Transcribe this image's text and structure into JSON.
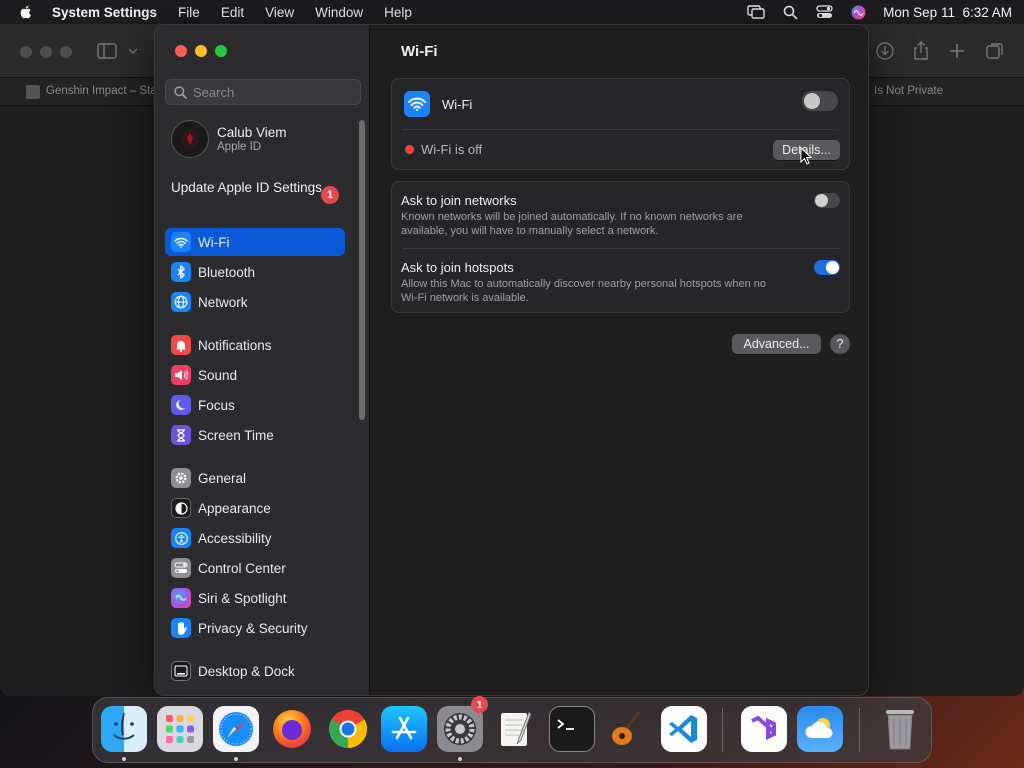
{
  "menubar": {
    "app_name": "System Settings",
    "items": [
      "File",
      "Edit",
      "View",
      "Window",
      "Help"
    ],
    "clock": "Mon Sep 11  6:32 AM"
  },
  "browser": {
    "tab_left": "Genshin Impact – Sta",
    "tab_right": "Is Not Private"
  },
  "sidebar": {
    "search_placeholder": "Search",
    "profile": {
      "name": "Calub Viem",
      "subtitle": "Apple ID"
    },
    "update": {
      "label": "Update Apple ID Settings",
      "badge": "1"
    },
    "items": [
      {
        "label": "Wi-Fi",
        "icon": "wifi-icon",
        "color": "#1a84ff"
      },
      {
        "label": "Bluetooth",
        "icon": "bluetooth-icon",
        "color": "#1a84ff"
      },
      {
        "label": "Network",
        "icon": "globe-icon",
        "color": "#1a84ff"
      },
      {
        "label": "Notifications",
        "icon": "bell-icon",
        "color": "#ef4a4a"
      },
      {
        "label": "Sound",
        "icon": "speaker-icon",
        "color": "#ef3f68"
      },
      {
        "label": "Focus",
        "icon": "moon-icon",
        "color": "#5e5ce6"
      },
      {
        "label": "Screen Time",
        "icon": "hourglass-icon",
        "color": "#6e52d8"
      },
      {
        "label": "General",
        "icon": "gear-icon",
        "color": "#8e8e93"
      },
      {
        "label": "Appearance",
        "icon": "appearance-icon",
        "color": "#1c1c1e"
      },
      {
        "label": "Accessibility",
        "icon": "accessibility-icon",
        "color": "#1a84ff"
      },
      {
        "label": "Control Center",
        "icon": "control-center-icon",
        "color": "#8e8e93"
      },
      {
        "label": "Siri & Spotlight",
        "icon": "siri-icon",
        "color": "#b04ad8"
      },
      {
        "label": "Privacy & Security",
        "icon": "hand-icon",
        "color": "#1a84ff"
      },
      {
        "label": "Desktop & Dock",
        "icon": "dock-icon",
        "color": "#1c1c1e"
      }
    ]
  },
  "content": {
    "title": "Wi-Fi",
    "wifi_label": "Wi-Fi",
    "wifi_enabled": false,
    "status_text": "Wi-Fi is off",
    "status_color": "#ff453a",
    "details_button": "Details...",
    "ask_networks": {
      "title": "Ask to join networks",
      "desc_line1": "Known networks will be joined automatically. If no known networks are",
      "desc_line2": "available, you will have to manually select a network.",
      "enabled": false
    },
    "ask_hotspots": {
      "title": "Ask to join hotspots",
      "desc_line1": "Allow this Mac to automatically discover nearby personal hotspots when no",
      "desc_line2": "Wi-Fi network is available.",
      "enabled": true
    },
    "advanced_button": "Advanced...",
    "help_button": "?"
  },
  "dock": {
    "apps": [
      {
        "name": "Finder",
        "running": true
      },
      {
        "name": "Launchpad",
        "running": false
      },
      {
        "name": "Safari",
        "running": true
      },
      {
        "name": "Firefox",
        "running": false
      },
      {
        "name": "Chrome",
        "running": false
      },
      {
        "name": "App Store",
        "running": false
      },
      {
        "name": "System Settings",
        "running": true,
        "badge": "1"
      },
      {
        "name": "TextEdit",
        "running": false
      },
      {
        "name": "Terminal",
        "running": false
      },
      {
        "name": "GarageBand",
        "running": false
      },
      {
        "name": "Visual Studio Code",
        "running": false
      },
      {
        "name": "Visual Studio",
        "running": false
      },
      {
        "name": "Weather",
        "running": false
      },
      {
        "name": "Trash",
        "running": false
      }
    ]
  }
}
